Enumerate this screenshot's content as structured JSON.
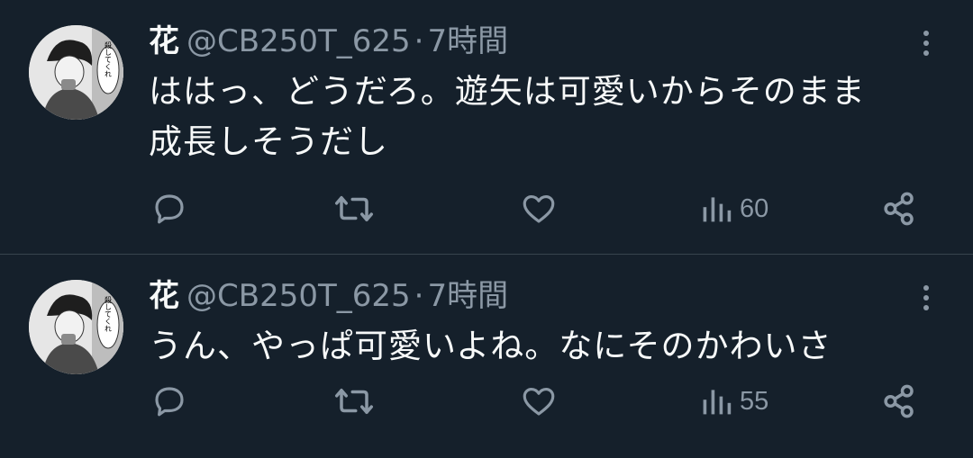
{
  "tweets": [
    {
      "display_name": "花",
      "handle": "@CB250T_625",
      "separator": "·",
      "time": "7時間",
      "text_lines": [
        "ははっ、どうだろ。遊矢は可愛いからそのまま",
        "成長しそうだし"
      ],
      "views": "60"
    },
    {
      "display_name": "花",
      "handle": "@CB250T_625",
      "separator": "·",
      "time": "7時間",
      "text_lines": [
        "うん、やっぱ可愛いよね。なにそのかわいさ"
      ],
      "views": "55"
    }
  ],
  "avatar_caption": "殺してくれ",
  "colors": {
    "background": "#15202b",
    "text": "#f7f9f9",
    "muted": "#8b98a5",
    "icon": "#8b98a5",
    "divider": "#38444d"
  },
  "icons": [
    "reply-icon",
    "retweet-icon",
    "like-icon",
    "views-icon",
    "share-icon",
    "more-icon"
  ]
}
